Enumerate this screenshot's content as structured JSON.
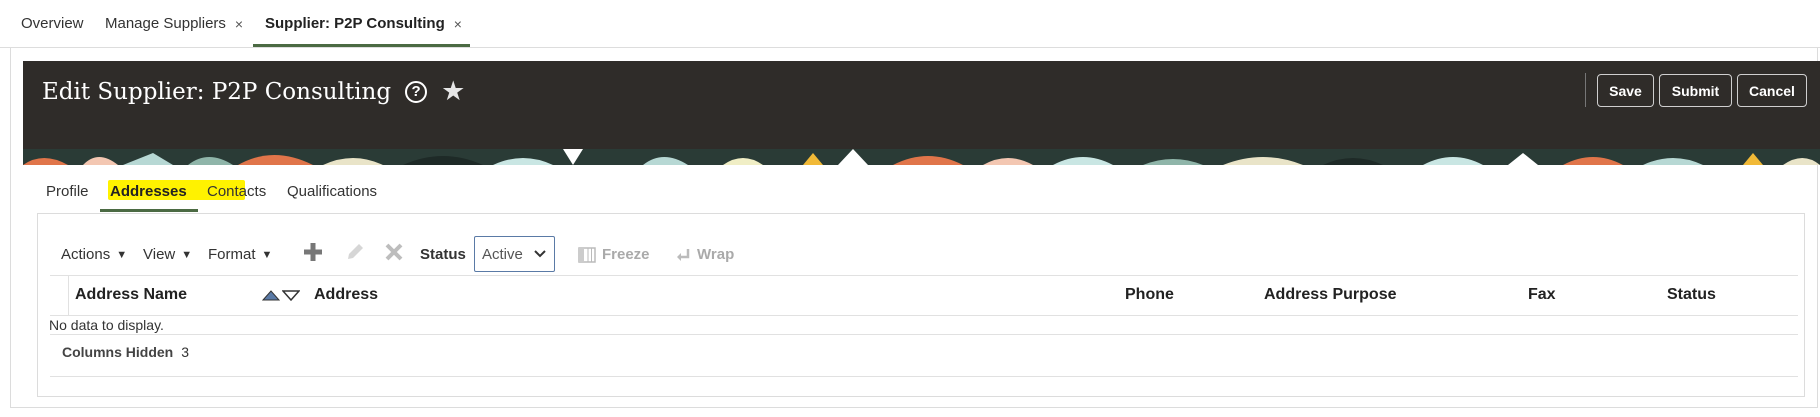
{
  "top_tabs": [
    {
      "label": "Overview"
    },
    {
      "label": "Manage Suppliers",
      "close": "×"
    },
    {
      "label": "Supplier: P2P Consulting",
      "close": "×"
    }
  ],
  "header": {
    "title": "Edit Supplier: P2P Consulting",
    "help_glyph": "?",
    "star_glyph": "★",
    "save_label": "Save",
    "submit_label": "Submit",
    "cancel_label": "Cancel"
  },
  "sub_tabs": [
    "Profile",
    "Addresses",
    "Contacts",
    "Qualifications"
  ],
  "toolbar": {
    "actions_label": "Actions",
    "view_label": "View",
    "format_label": "Format",
    "caret": "▼",
    "add_icon": "plus-icon",
    "edit_icon": "pencil-icon",
    "delete_icon": "x-icon",
    "status_label": "Status",
    "status_value": "Active",
    "freeze_label": "Freeze",
    "wrap_label": "Wrap"
  },
  "table": {
    "columns": [
      "Address Name",
      "Address",
      "Phone",
      "Address Purpose",
      "Fax",
      "Status"
    ],
    "empty_text": "No data to display.",
    "columns_hidden_label": "Columns Hidden",
    "columns_hidden_count": "3"
  },
  "colors": {
    "header_bg": "#2f2c29",
    "accent_green": "#4b6a43",
    "highlight": "#fff200",
    "select_border": "#5a7aa6"
  }
}
